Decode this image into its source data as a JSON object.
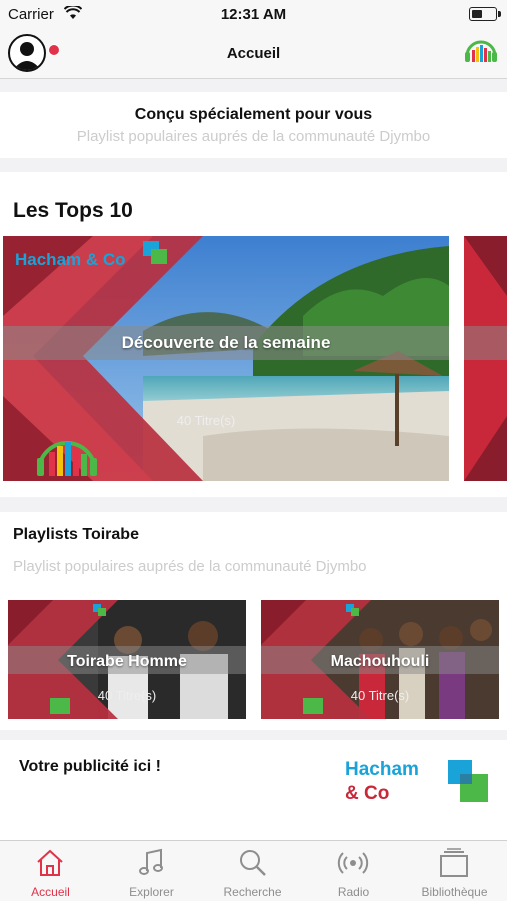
{
  "status_bar": {
    "carrier": "Carrier",
    "time": "12:31 AM"
  },
  "nav": {
    "title": "Accueil"
  },
  "featured": {
    "title": "Conçu spécialement pour vous",
    "subtitle": "Playlist populaires auprés de la communauté Djymbo"
  },
  "tops": {
    "title": "Les Tops 10",
    "banner_brand": "Hacham & Co",
    "banner_label": "Découverte de la semaine",
    "banner_count": "40 Titre(s)"
  },
  "toirabe": {
    "title": "Playlists Toirabe",
    "subtitle": "Playlist populaires auprés de la communauté Djymbo",
    "tiles": [
      {
        "label": "Toirabe Homme",
        "count": "40 Titre(s)"
      },
      {
        "label": "Machouhouli",
        "count": "40 Titre(s)"
      }
    ]
  },
  "ad": {
    "title": "Votre publicité ici !",
    "logo_line1": "Hacham",
    "logo_line2": "& Co"
  },
  "tabs": [
    {
      "label": "Accueil",
      "icon": "home-icon",
      "active": true
    },
    {
      "label": "Explorer",
      "icon": "music-note-icon",
      "active": false
    },
    {
      "label": "Recherche",
      "icon": "search-icon",
      "active": false
    },
    {
      "label": "Radio",
      "icon": "radio-icon",
      "active": false
    },
    {
      "label": "Bibliothèque",
      "icon": "library-icon",
      "active": false
    }
  ],
  "colors": {
    "accent": "#e0334a",
    "brand_red": "#c8283a",
    "brand_blue": "#1aa3d9",
    "brand_green": "#4cb848"
  }
}
